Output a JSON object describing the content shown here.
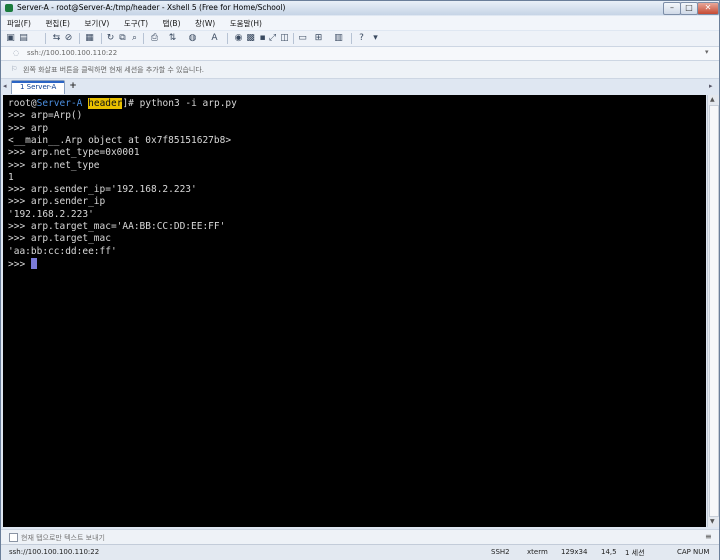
{
  "window": {
    "title": "Server-A - root@Server-A:/tmp/header - Xshell 5 (Free for Home/School)"
  },
  "menu": [
    "파일(F)",
    "편집(E)",
    "보기(V)",
    "도구(T)",
    "탭(B)",
    "창(W)",
    "도움말(H)"
  ],
  "address": {
    "value": "ssh://100.100.100.110:22"
  },
  "hint": {
    "text": "왼쪽 화살표 버튼을 클릭하면 현재 세션을 추가할 수 있습니다."
  },
  "tabs": [
    {
      "label": "1 Server-A",
      "active": true
    }
  ],
  "terminal": {
    "prompt_user": "root",
    "prompt_at": "@",
    "prompt_host": "Server-A",
    "prompt_space": " ",
    "prompt_dir": "header",
    "prompt_end": "]# ",
    "first_command": "python3 -i arp.py",
    "lines": [
      ">>> arp=Arp()",
      ">>> arp",
      "<__main__.Arp object at 0x7f85151627b8>",
      ">>> arp.net_type=0x0001",
      ">>> arp.net_type",
      "1",
      ">>> arp.sender_ip='192.168.2.223'",
      ">>> arp.sender_ip",
      "'192.168.2.223'",
      ">>> arp.target_mac='AA:BB:CC:DD:EE:FF'",
      ">>> arp.target_mac",
      "'aa:bb:cc:dd:ee:ff'"
    ],
    "last_prompt": ">>> "
  },
  "compose": {
    "text": "현재 탭으로만 텍스트 보내기"
  },
  "status": {
    "address": "ssh://100.100.100.110:22",
    "protocol": "SSH2",
    "term": "xterm",
    "size": "129x34",
    "position": "14,5",
    "sessions": "1 세션",
    "cap": "CAP",
    "num": "NUM"
  },
  "colors": {
    "terminal_bg": "#000000",
    "terminal_fg": "#d8d8d8",
    "hostname": "#4c8fe0",
    "dir_highlight": "#e8c000",
    "cursor": "#7a7ad8"
  }
}
